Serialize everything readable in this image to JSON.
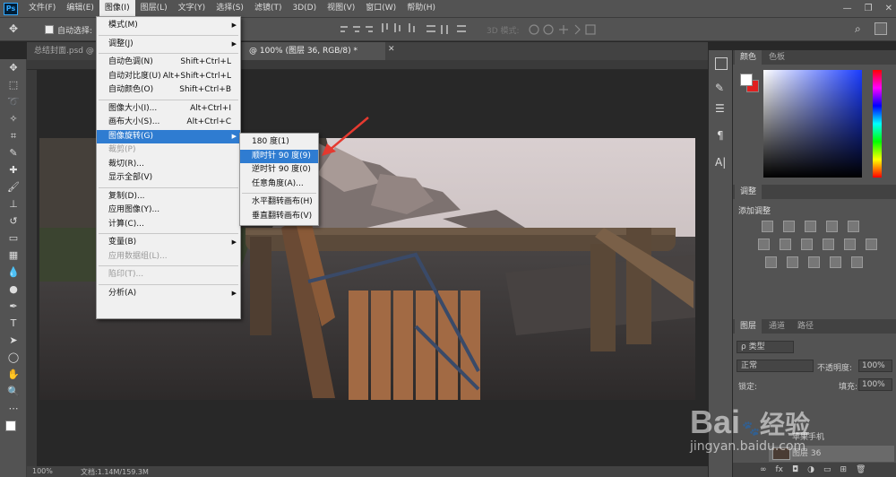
{
  "app": {
    "logo": "Ps"
  },
  "menubar": {
    "items": [
      "文件(F)",
      "编辑(E)",
      "图像(I)",
      "图层(L)",
      "文字(Y)",
      "选择(S)",
      "滤镜(T)",
      "3D(D)",
      "视图(V)",
      "窗口(W)",
      "帮助(H)"
    ],
    "window_controls": [
      "—",
      "❐",
      "✕"
    ]
  },
  "options": {
    "auto_select_label": "自动选择:",
    "mode3d_label": "3D 模式:"
  },
  "tabs": [
    {
      "label": "总结封面.psd @ 5..."
    },
    {
      "label": "@ 100% (图层 36, RGB/8) *"
    }
  ],
  "image_menu": {
    "items": [
      {
        "label": "模式(M)",
        "shortcut": "",
        "submenu": true,
        "disabled": false
      },
      {
        "sep": true
      },
      {
        "label": "调整(J)",
        "shortcut": "",
        "submenu": true,
        "disabled": false
      },
      {
        "sep": true
      },
      {
        "label": "自动色调(N)",
        "shortcut": "Shift+Ctrl+L",
        "submenu": false,
        "disabled": false
      },
      {
        "label": "自动对比度(U)",
        "shortcut": "Alt+Shift+Ctrl+L",
        "submenu": false,
        "disabled": false
      },
      {
        "label": "自动颜色(O)",
        "shortcut": "Shift+Ctrl+B",
        "submenu": false,
        "disabled": false
      },
      {
        "sep": true
      },
      {
        "label": "图像大小(I)...",
        "shortcut": "Alt+Ctrl+I",
        "submenu": false,
        "disabled": false
      },
      {
        "label": "画布大小(S)...",
        "shortcut": "Alt+Ctrl+C",
        "submenu": false,
        "disabled": false
      },
      {
        "label": "图像旋转(G)",
        "shortcut": "",
        "submenu": true,
        "disabled": false,
        "highlight": true
      },
      {
        "label": "裁剪(P)",
        "shortcut": "",
        "submenu": false,
        "disabled": true
      },
      {
        "label": "裁切(R)...",
        "shortcut": "",
        "submenu": false,
        "disabled": false
      },
      {
        "label": "显示全部(V)",
        "shortcut": "",
        "submenu": false,
        "disabled": false
      },
      {
        "sep": true
      },
      {
        "label": "复制(D)...",
        "shortcut": "",
        "submenu": false,
        "disabled": false
      },
      {
        "label": "应用图像(Y)...",
        "shortcut": "",
        "submenu": false,
        "disabled": false
      },
      {
        "label": "计算(C)...",
        "shortcut": "",
        "submenu": false,
        "disabled": false
      },
      {
        "sep": true
      },
      {
        "label": "变量(B)",
        "shortcut": "",
        "submenu": true,
        "disabled": false
      },
      {
        "label": "应用数据组(L)...",
        "shortcut": "",
        "submenu": false,
        "disabled": true
      },
      {
        "sep": true
      },
      {
        "label": "陷印(T)...",
        "shortcut": "",
        "submenu": false,
        "disabled": true
      },
      {
        "sep": true
      },
      {
        "label": "分析(A)",
        "shortcut": "",
        "submenu": true,
        "disabled": false
      }
    ]
  },
  "rotate_submenu": {
    "items": [
      {
        "label": "180 度(1)"
      },
      {
        "label": "顺时针 90 度(9)",
        "highlight": true
      },
      {
        "label": "逆时针 90 度(0)"
      },
      {
        "label": "任意角度(A)..."
      },
      {
        "sep": true
      },
      {
        "label": "水平翻转画布(H)"
      },
      {
        "label": "垂直翻转画布(V)"
      }
    ]
  },
  "status": {
    "zoom": "100%",
    "doc": "文档:1.14M/159.3M"
  },
  "panels": {
    "color": {
      "tabs": [
        "颜色",
        "色板"
      ]
    },
    "adjust": {
      "title": "调整",
      "subtitle": "添加调整"
    },
    "layers": {
      "tabs": [
        "图层",
        "通道",
        "路径"
      ],
      "filter_label": "ρ 类型",
      "blend_mode": "正常",
      "opacity_label": "不透明度:",
      "opacity_value": "100%",
      "lock_label": "锁定:",
      "fill_label": "填充:",
      "fill_value": "100%",
      "layer_rows": [
        "苹果手机",
        "图层 36"
      ]
    }
  },
  "watermark": {
    "brand": "Bai",
    "brand_cn": "经验",
    "url": "jingyan.baidu.com"
  },
  "colors": {
    "accent": "#2f7cd1",
    "arrow": "#e53a30",
    "fg": "#ffffff",
    "bg": "#e02020"
  }
}
